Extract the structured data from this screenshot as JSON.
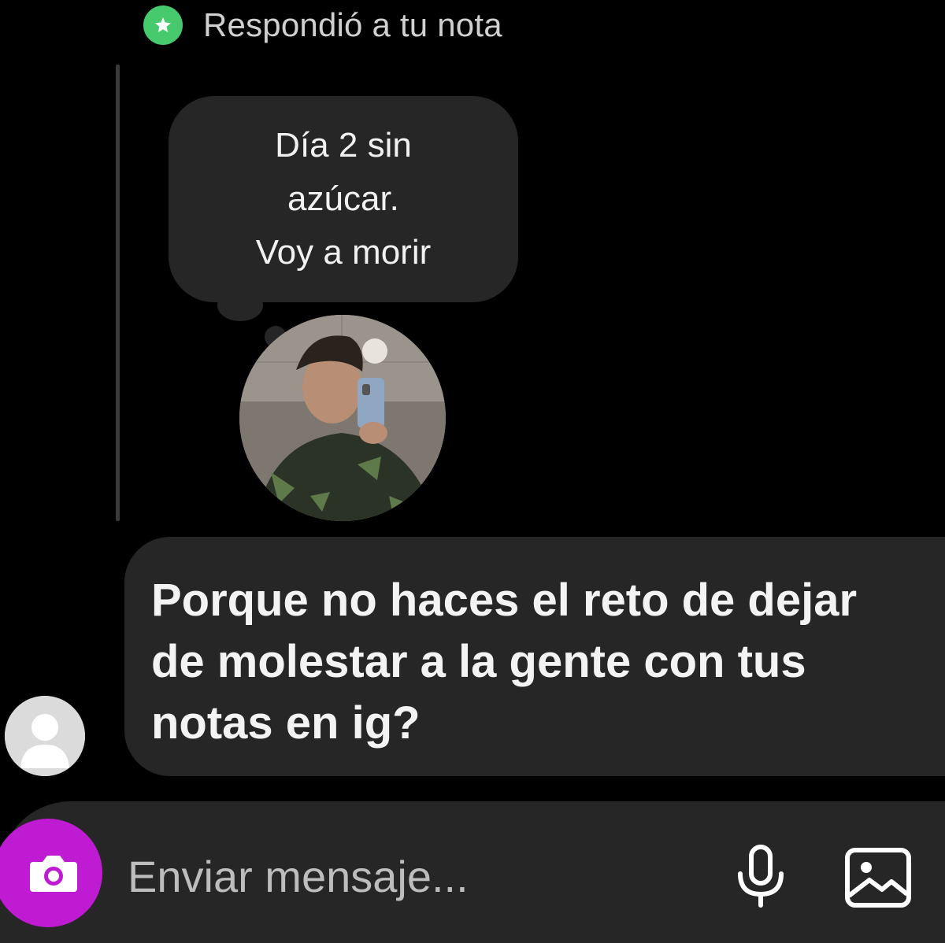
{
  "header": {
    "reply_label": "Respondió a tu nota",
    "badge_icon": "star-icon",
    "badge_color": "#47c96d"
  },
  "note": {
    "text": "Día 2 sin\nazúcar.\nVoy a morir",
    "avatar_icon": "profile-photo"
  },
  "message": {
    "text": "Porque no haces el reto de dejar\nde molestar a la gente con tus\nnotas en ig?",
    "sender_avatar_icon": "default-user-icon"
  },
  "composer": {
    "placeholder": "Enviar mensaje...",
    "camera_icon": "camera-icon",
    "camera_color": "#bf1bd3",
    "mic_icon": "microphone-icon",
    "gallery_icon": "gallery-icon"
  }
}
